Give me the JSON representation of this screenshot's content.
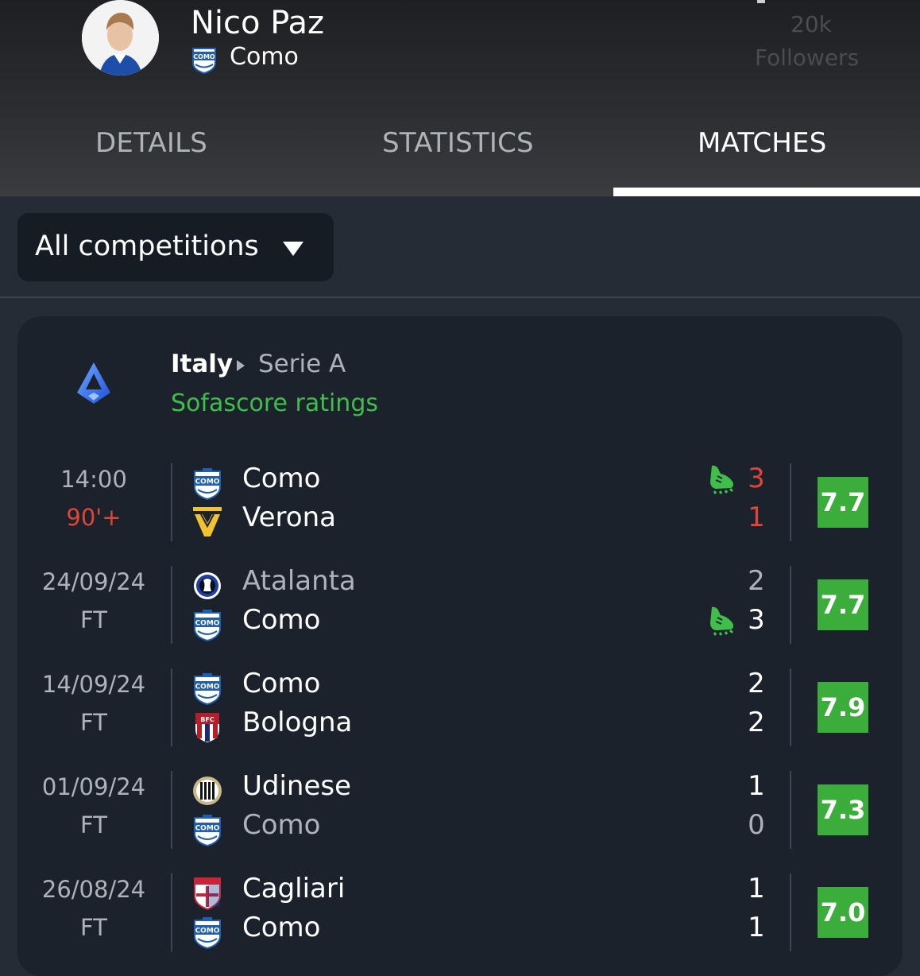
{
  "player": {
    "name": "Nico Paz",
    "team": "Como"
  },
  "followers": {
    "count": "20k",
    "label": "Followers"
  },
  "tabs": [
    {
      "label": "DETAILS",
      "active": false
    },
    {
      "label": "STATISTICS",
      "active": false
    },
    {
      "label": "MATCHES",
      "active": true
    }
  ],
  "filter": {
    "selected": "All competitions"
  },
  "league": {
    "country": "Italy",
    "name": "Serie A",
    "ratings_label": "Sofascore ratings"
  },
  "colors": {
    "live": "#e0453a",
    "rating_green": "#3aad3a",
    "link_green": "#3fbf4a",
    "card_bg": "#1c222b",
    "page_bg": "#252c35"
  },
  "matches": [
    {
      "date": "14:00",
      "status": "90'+",
      "live": true,
      "home": {
        "name": "Como",
        "score": "3",
        "logo": "como-crest"
      },
      "away": {
        "name": "Verona",
        "score": "1",
        "logo": "verona-crest"
      },
      "boot_icon_on": "home",
      "rating": "7.7"
    },
    {
      "date": "24/09/24",
      "status": "FT",
      "live": false,
      "home": {
        "name": "Atalanta",
        "score": "2",
        "logo": "atalanta-crest"
      },
      "away": {
        "name": "Como",
        "score": "3",
        "logo": "como-crest"
      },
      "boot_icon_on": "away",
      "rating": "7.7"
    },
    {
      "date": "14/09/24",
      "status": "FT",
      "live": false,
      "home": {
        "name": "Como",
        "score": "2",
        "logo": "como-crest"
      },
      "away": {
        "name": "Bologna",
        "score": "2",
        "logo": "bologna-crest"
      },
      "boot_icon_on": null,
      "rating": "7.9"
    },
    {
      "date": "01/09/24",
      "status": "FT",
      "live": false,
      "home": {
        "name": "Udinese",
        "score": "1",
        "logo": "udinese-crest"
      },
      "away": {
        "name": "Como",
        "score": "0",
        "logo": "como-crest"
      },
      "boot_icon_on": null,
      "rating": "7.3"
    },
    {
      "date": "26/08/24",
      "status": "FT",
      "live": false,
      "home": {
        "name": "Cagliari",
        "score": "1",
        "logo": "cagliari-crest"
      },
      "away": {
        "name": "Como",
        "score": "1",
        "logo": "como-crest"
      },
      "boot_icon_on": null,
      "rating": "7.0"
    }
  ]
}
